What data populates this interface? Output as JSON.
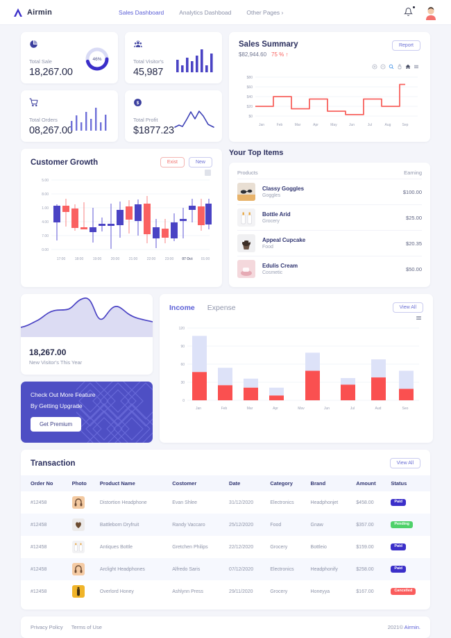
{
  "header": {
    "brand": "Airmin",
    "nav": [
      {
        "label": "Sales Dashboard",
        "active": true
      },
      {
        "label": "Analytics Dashboad",
        "active": false
      },
      {
        "label": "Other Pages",
        "active": false,
        "caret": true
      }
    ],
    "bell_icon": "bell-icon",
    "avatar_icon": "user-avatar"
  },
  "stats": [
    {
      "label": "Total Sale",
      "value": "18,267.00",
      "icon": "pie-chart-icon",
      "visual": "donut",
      "percent": "46%"
    },
    {
      "label": "Total Visitor's",
      "value": "45,987",
      "icon": "users-icon",
      "visual": "bars"
    },
    {
      "label": "Total Orders",
      "value": "08,267.00",
      "icon": "cart-icon",
      "visual": "thin-bars"
    },
    {
      "label": "Total Profit",
      "value": "$1877.23",
      "icon": "dollar-icon",
      "visual": "line"
    }
  ],
  "sales_summary": {
    "title": "Sales Summary",
    "amount": "$82,944.60",
    "delta": "75 %",
    "delta_arrow": "↑",
    "report_label": "Report",
    "tools": [
      "zoom-in-icon",
      "zoom-out-icon",
      "selection-icon",
      "pan-icon",
      "home-icon",
      "menu-icon"
    ]
  },
  "customer_growth": {
    "title": "Customer Growth",
    "exit_label": "Exist",
    "new_label": "New",
    "menu_icon": "menu-icon"
  },
  "top_items": {
    "title": "Your Top Items",
    "col_products": "Products",
    "col_earning": "Earning",
    "items": [
      {
        "name": "Classy Goggles",
        "category": "Goggles",
        "earning": "$100.00",
        "thumb": "goggles"
      },
      {
        "name": "Bottle Arid",
        "category": "Grocery",
        "earning": "$25.00",
        "thumb": "bottle"
      },
      {
        "name": "Appeal Cupcake",
        "category": "Food",
        "earning": "$20.35",
        "thumb": "cupcake"
      },
      {
        "name": "Edulis Cream",
        "category": "Cosmetic",
        "earning": "$50.00",
        "thumb": "cream"
      }
    ]
  },
  "visitors": {
    "value": "18,267.00",
    "label": "New Visitor's This Year"
  },
  "promo": {
    "line1": "Check Out More Feature",
    "line2": "By Getting Upgrade",
    "button": "Get Premium"
  },
  "income_expense": {
    "tabs": [
      {
        "label": "Income",
        "active": true
      },
      {
        "label": "Expense",
        "active": false
      }
    ],
    "view_all": "View All",
    "menu_icon": "menu-icon"
  },
  "transaction": {
    "title": "Transaction",
    "view_all": "View All",
    "columns": [
      "Order No",
      "Photo",
      "Product Name",
      "Costomer",
      "Date",
      "Category",
      "Brand",
      "Amount",
      "Status"
    ],
    "rows": [
      {
        "order": "#12458",
        "thumb": "headphone",
        "product": "Distortion Headphone",
        "customer": "Evan Shlee",
        "date": "31/12/2020",
        "category": "Electronics",
        "brand": "Headphonjet",
        "amount": "$458.00",
        "status": "Paid"
      },
      {
        "order": "#12458",
        "thumb": "dryfruit",
        "product": "Battleborn Dryfruit",
        "customer": "Randy Vaccaro",
        "date": "25/12/2020",
        "category": "Food",
        "brand": "Gnaw",
        "amount": "$357.00",
        "status": "Pending"
      },
      {
        "order": "#12458",
        "thumb": "bottle",
        "product": "Antiques Bottle",
        "customer": "Gretchen Philips",
        "date": "22/12/2020",
        "category": "Grocery",
        "brand": "Bottleio",
        "amount": "$159.00",
        "status": "Paid"
      },
      {
        "order": "#12458",
        "thumb": "headphone",
        "product": "Arclight Headphones",
        "customer": "Alfredo Saris",
        "date": "07/12/2020",
        "category": "Electronics",
        "brand": "Headphonify",
        "amount": "$258.00",
        "status": "Paid"
      },
      {
        "order": "#12458",
        "thumb": "honey",
        "product": "Overlord Honey",
        "customer": "Ashlynn Press",
        "date": "29/11/2020",
        "category": "Grocery",
        "brand": "Honeyya",
        "amount": "$167.00",
        "status": "Cancelled"
      }
    ]
  },
  "footer": {
    "privacy": "Privacy Policy",
    "terms": "Terms of Use",
    "copyright": "2021©",
    "brand": "Airmin."
  },
  "colors": {
    "accent": "#5a5ed6",
    "red": "#fa5c5c",
    "indigo": "#3b2fc9",
    "green": "#4fd16a",
    "bg": "#f4f5fa"
  },
  "chart_data": [
    {
      "type": "line",
      "name": "sales-summary-step-chart",
      "title": "Sales Summary",
      "step": true,
      "categories": [
        "Jan",
        "Feb",
        "Mar",
        "Apr",
        "May",
        "Jun",
        "Jul",
        "Aug",
        "Sep"
      ],
      "values": [
        20,
        40,
        15,
        35,
        10,
        3,
        35,
        20,
        65
      ],
      "ytick_labels": [
        "$0",
        "$20",
        "$40",
        "$60",
        "$80"
      ],
      "yticks": [
        0,
        20,
        40,
        60,
        80
      ],
      "ylim": [
        0,
        80
      ],
      "xlabel": "",
      "ylabel": "",
      "color": "#f8605c",
      "grid": true,
      "legend": "none"
    },
    {
      "type": "candlestick",
      "name": "customer-growth-candlestick",
      "title": "Customer Growth",
      "ytick_labels": [
        "0.00",
        "7.00",
        "4.00",
        "1.00",
        "8.00",
        "5.00"
      ],
      "xtick_labels": [
        "17:00",
        "18:00",
        "19:00",
        "20:00",
        "21:00",
        "22:00",
        "23:00",
        "07 Oct",
        "01:00"
      ],
      "ylim": [
        0,
        100
      ],
      "up_color": "#4a43c4",
      "down_color": "#fa6161",
      "candles": [
        {
          "open": 62,
          "close": 45,
          "high": 66,
          "low": 22,
          "dir": "down"
        },
        {
          "open": 60,
          "close": 68,
          "high": 80,
          "low": 52,
          "dir": "up"
        },
        {
          "open": 64,
          "close": 34,
          "high": 66,
          "low": 30,
          "dir": "down"
        },
        {
          "open": 34,
          "close": 33,
          "high": 70,
          "low": 30,
          "dir": "down"
        },
        {
          "open": 30,
          "close": 33,
          "high": 62,
          "low": 14,
          "dir": "down"
        },
        {
          "open": 38,
          "close": 39,
          "high": 44,
          "low": 32,
          "dir": "up"
        },
        {
          "open": 38,
          "close": 39,
          "high": 72,
          "low": 6,
          "dir": "up"
        },
        {
          "open": 40,
          "close": 58,
          "high": 72,
          "low": 24,
          "dir": "up"
        },
        {
          "open": 48,
          "close": 62,
          "high": 70,
          "low": 36,
          "dir": "down"
        },
        {
          "open": 44,
          "close": 66,
          "high": 72,
          "low": 28,
          "dir": "up"
        },
        {
          "open": 22,
          "close": 69,
          "high": 76,
          "low": 16,
          "dir": "down"
        },
        {
          "open": 34,
          "close": 25,
          "high": 44,
          "low": 10,
          "dir": "up"
        },
        {
          "open": 32,
          "close": 24,
          "high": 46,
          "low": 16,
          "dir": "down"
        },
        {
          "open": 40,
          "close": 22,
          "high": 50,
          "low": 20,
          "dir": "up"
        },
        {
          "open": 46,
          "close": 48,
          "high": 58,
          "low": 24,
          "dir": "up"
        },
        {
          "open": 57,
          "close": 60,
          "high": 72,
          "low": 50,
          "dir": "up"
        },
        {
          "open": 62,
          "close": 38,
          "high": 70,
          "low": 24,
          "dir": "down"
        },
        {
          "open": 66,
          "close": 40,
          "high": 72,
          "low": 34,
          "dir": "up"
        }
      ]
    },
    {
      "type": "bar",
      "name": "income-expense-stacked-bars",
      "title": "Income / Expense",
      "stacked": true,
      "categories": [
        "Jan",
        "Feb",
        "Mar",
        "Apr",
        "May",
        "Jun",
        "Jul",
        "Aug",
        "Sep"
      ],
      "series": [
        {
          "name": "Expense",
          "color": "#fa5050",
          "values": [
            47,
            25,
            21,
            8,
            0,
            49,
            26,
            38,
            19
          ]
        },
        {
          "name": "Income",
          "color": "#dde2f8",
          "values": [
            60,
            29,
            15,
            13,
            0,
            30,
            11,
            30,
            30
          ]
        }
      ],
      "ytick_labels": [
        "0",
        "30",
        "60",
        "90",
        "120"
      ],
      "yticks": [
        0,
        30,
        60,
        90,
        120
      ],
      "ylim": [
        0,
        120
      ],
      "grid": true
    },
    {
      "type": "area",
      "name": "new-visitors-area-chart",
      "values": [
        14,
        18,
        26,
        40,
        44,
        46,
        50,
        72,
        86,
        62,
        40,
        38,
        58,
        66,
        54,
        42,
        38,
        34
      ],
      "color": "#4a43c4",
      "fill": "#dcdcf3",
      "ylim": [
        0,
        100
      ]
    },
    {
      "type": "bar",
      "name": "total-visitors-mini-bars",
      "values": [
        52,
        28,
        62,
        48,
        70,
        100,
        30,
        80,
        60
      ],
      "color": "#4a43c4"
    },
    {
      "type": "bar",
      "name": "total-orders-mini-bars",
      "values": [
        40,
        62,
        34,
        78,
        52,
        100,
        34,
        66,
        48
      ],
      "color": "#6e6fd8"
    },
    {
      "type": "line",
      "name": "total-profit-mini-line",
      "values": [
        18,
        24,
        20,
        46,
        86,
        58,
        90,
        70,
        34,
        22
      ],
      "color": "#3b3fb5"
    },
    {
      "type": "pie",
      "name": "total-sale-donut",
      "values": [
        46,
        54
      ],
      "labels": [
        "46%",
        ""
      ],
      "colors": [
        "#3b2fc9",
        "#d9dbf5"
      ]
    }
  ]
}
